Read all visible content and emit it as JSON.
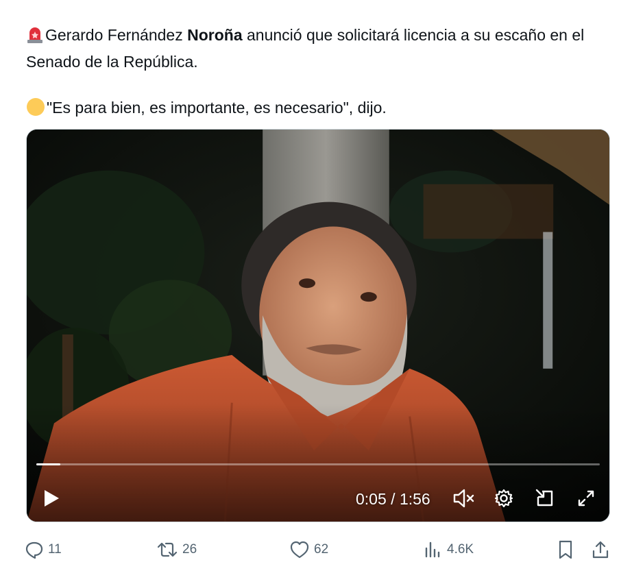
{
  "tweet": {
    "alert_emoji": "🚨",
    "line1_pre": "Gerardo Fernández ",
    "line1_bold": "Noroña",
    "line1_post": " anunció que solicitará licencia a su escaño en el Senado de la República.",
    "dot_emoji": "🟡",
    "line2": "\"Es para bien, es importante, es necesario\", dijo."
  },
  "video": {
    "current_time": "0:05",
    "separator": " / ",
    "duration": "1:56",
    "progress_fraction": 0.043,
    "icons": [
      "play-icon",
      "mute-icon",
      "settings-icon",
      "picture-in-picture-icon",
      "fullscreen-icon"
    ]
  },
  "actions": {
    "replies": "11",
    "retweets": "26",
    "likes": "62",
    "views": "4.6K"
  },
  "colors": {
    "text": "#0f1419",
    "muted": "#536471",
    "shirt": "#c4532e"
  }
}
